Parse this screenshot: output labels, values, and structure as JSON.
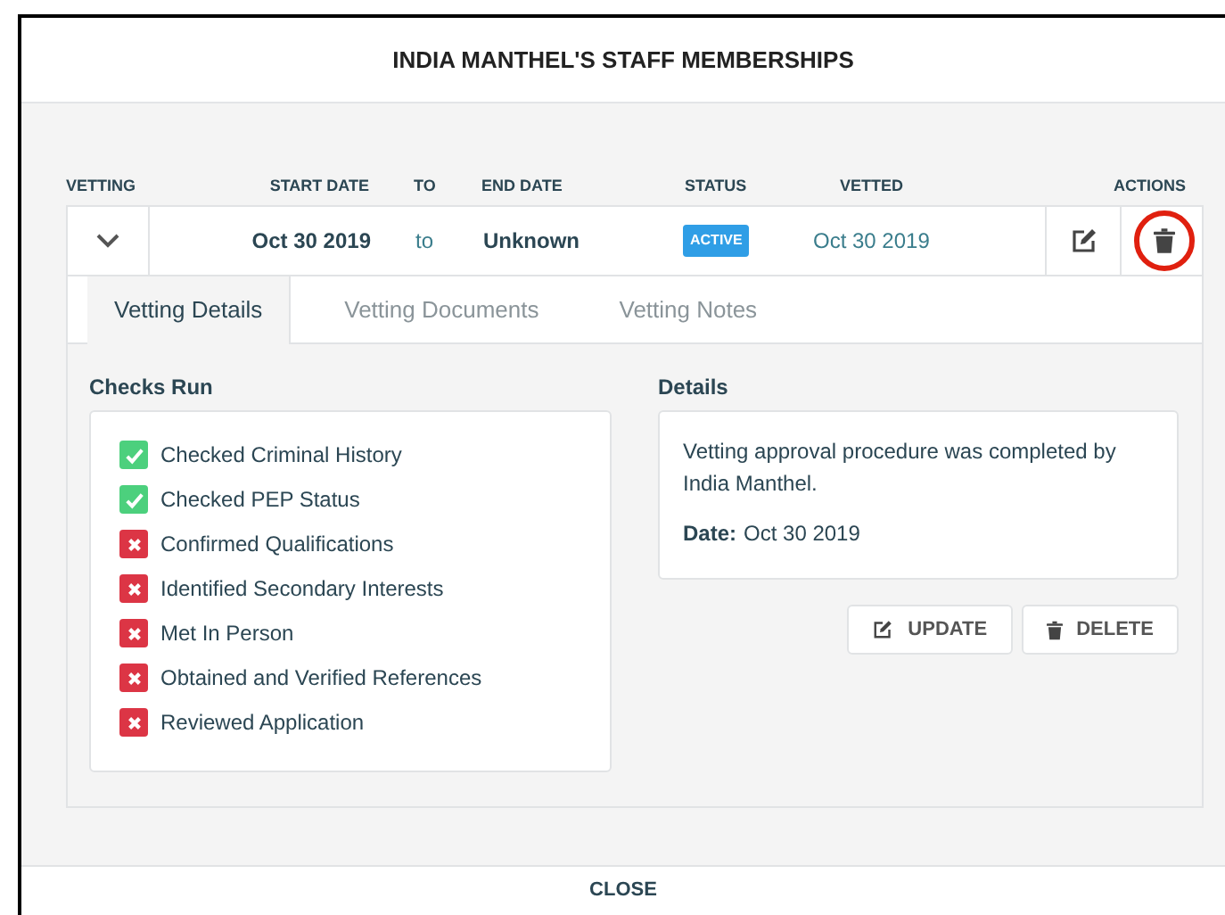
{
  "dialog": {
    "title": "INDIA MANTHEL'S STAFF MEMBERSHIPS"
  },
  "table": {
    "columns": [
      "VETTING",
      "START DATE",
      "TO",
      "END DATE",
      "STATUS",
      "VETTED",
      "ACTIONS"
    ],
    "rows": [
      {
        "expanded": true,
        "start_date": "Oct 30 2019",
        "to": "to",
        "end_date": "Unknown",
        "status": "ACTIVE",
        "vetted": "Oct 30 2019",
        "delete_highlighted": true
      }
    ]
  },
  "tabs": [
    {
      "label": "Vetting Details",
      "selected": true
    },
    {
      "label": "Vetting Documents",
      "selected": false
    },
    {
      "label": "Vetting Notes",
      "selected": false
    }
  ],
  "checks": {
    "title": "Checks Run",
    "items": [
      {
        "label": "Checked Criminal History",
        "passed": true
      },
      {
        "label": "Checked PEP Status",
        "passed": true
      },
      {
        "label": "Confirmed Qualifications",
        "passed": false
      },
      {
        "label": "Identified Secondary Interests",
        "passed": false
      },
      {
        "label": "Met In Person",
        "passed": false
      },
      {
        "label": "Obtained and Verified References",
        "passed": false
      },
      {
        "label": "Reviewed Application",
        "passed": false
      }
    ]
  },
  "details": {
    "title": "Details",
    "text": "Vetting approval procedure was completed by India Manthel.",
    "date_label": "Date:",
    "date": "Oct 30 2019"
  },
  "buttons": [
    {
      "label": "UPDATE",
      "kind": "update"
    },
    {
      "label": "DELETE",
      "kind": "delete"
    }
  ],
  "footer": {
    "button": "CLOSE"
  }
}
